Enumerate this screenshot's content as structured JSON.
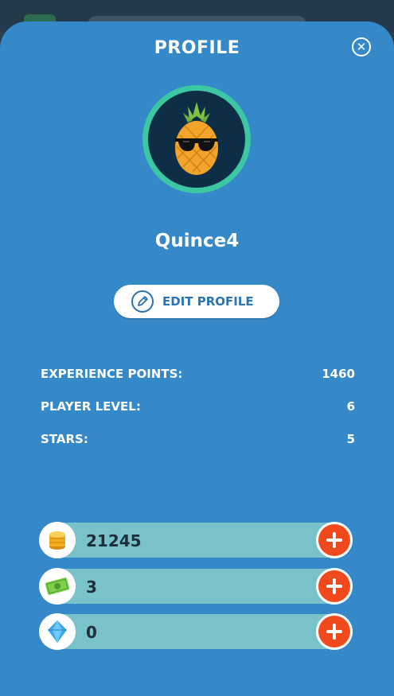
{
  "header": {
    "title": "PROFILE",
    "close_icon": "close-icon"
  },
  "profile": {
    "username": "Quince4",
    "avatar": "pineapple-with-sunglasses"
  },
  "edit_button": {
    "label": "EDIT PROFILE",
    "icon": "pencil-icon"
  },
  "stats": [
    {
      "label": "EXPERIENCE POINTS:",
      "value": "1460"
    },
    {
      "label": "PLAYER LEVEL:",
      "value": "6"
    },
    {
      "label": "STARS:",
      "value": "5"
    }
  ],
  "currencies": [
    {
      "icon": "coins-icon",
      "value": "21245"
    },
    {
      "icon": "cash-icon",
      "value": "3"
    },
    {
      "icon": "diamond-icon",
      "value": "0"
    }
  ],
  "colors": {
    "panel": "#3589c8",
    "accent_ring": "#3cc8a2",
    "plus_button": "#f04a1c",
    "currency_bar": "#79c2ca"
  }
}
